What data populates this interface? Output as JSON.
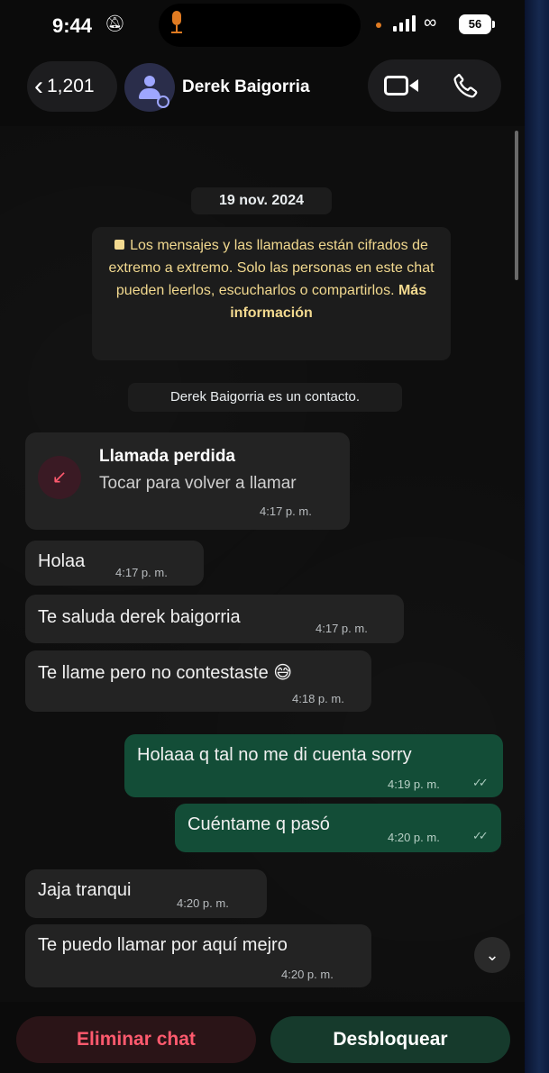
{
  "status_bar": {
    "time": "9:44",
    "bell_icon": "bell-slash-icon",
    "battery": "56"
  },
  "header": {
    "back_count": "1,201",
    "contact_name": "Derek Baigorria"
  },
  "chat": {
    "date": "19 nov. 2024",
    "e2e_notice": "Los mensajes y las llamadas están cifrados de extremo a extremo. Solo las personas en este chat pueden leerlos, escucharlos o compartirlos.",
    "e2e_more": "Más información",
    "contact_info": "Derek Baigorria es un contacto.",
    "missed_call": {
      "title": "Llamada perdida",
      "subtitle": "Tocar para volver a llamar",
      "time": "4:17 p. m."
    },
    "messages": [
      {
        "text": "Holaa",
        "time": "4:17 p. m.",
        "direction": "in"
      },
      {
        "text": "Te saluda derek baigorria",
        "time": "4:17 p. m.",
        "direction": "in"
      },
      {
        "text": "Te llame pero no contestaste 😅",
        "time": "4:18 p. m.",
        "direction": "in"
      },
      {
        "text": "Holaaa q tal no me di cuenta sorry",
        "time": "4:19 p. m.",
        "direction": "out"
      },
      {
        "text": "Cuéntame q pasó",
        "time": "4:20 p. m.",
        "direction": "out"
      },
      {
        "text": "Jaja tranqui",
        "time": "4:20 p. m.",
        "direction": "in"
      },
      {
        "text": "Te puedo llamar por aquí mejro",
        "time": "4:20 p. m.",
        "direction": "in"
      }
    ]
  },
  "bottom_bar": {
    "delete_label": "Eliminar chat",
    "unblock_label": "Desbloquear"
  },
  "colors": {
    "incoming_bubble": "#232323",
    "outgoing_bubble": "#134d37",
    "delete_text": "#ff5a6e",
    "notice_text": "#f2d98f"
  }
}
